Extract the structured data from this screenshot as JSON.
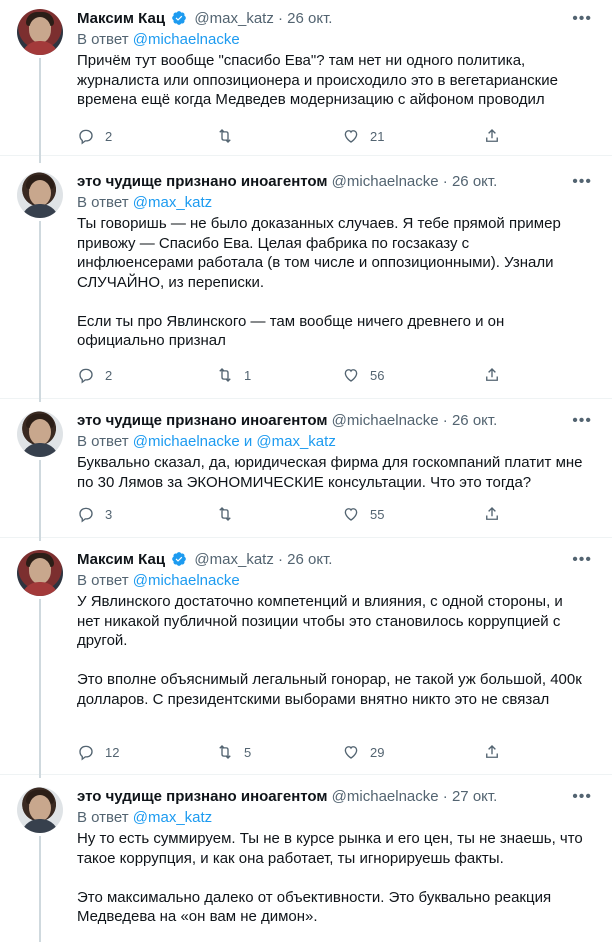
{
  "tweets": [
    {
      "name": "Максим Кац",
      "verified": true,
      "handle": "@max_katz",
      "date": "26 окт.",
      "reply_prefix": "В ответ ",
      "reply_mentions": "@michaelnacke",
      "text": "Причём тут вообще \"спасибо Ева\"? там нет ни одного политика, журналиста или оппозиционера и происходило это в вегетарианские времена ещё когда Медведев модернизацию с айфоном проводил",
      "replies": "2",
      "retweets": "",
      "likes": "21",
      "more": "•••"
    },
    {
      "name": "это чудище признано иноагентом",
      "verified": false,
      "handle": "@michaelnacke",
      "date": "26 окт.",
      "reply_prefix": "В ответ ",
      "reply_mentions": "@max_katz",
      "text": "Ты говоришь — не было доказанных случаев. Я тебе прямой пример привожу — Спасибо Ева. Целая фабрика по госзаказу с инфлюенсерами работала (в том числе и оппозиционными). Узнали СЛУЧАЙНО, из переписки.\n\nЕсли ты про Явлинского — там вообще ничего древнего и он официально признал",
      "replies": "2",
      "retweets": "1",
      "likes": "56",
      "more": "•••"
    },
    {
      "name": "это чудище признано иноагентом",
      "verified": false,
      "handle": "@michaelnacke",
      "date": "26 окт.",
      "reply_prefix": "В ответ ",
      "reply_mentions": "@michaelnacke и @max_katz",
      "text": "Буквально сказал, да, юридическая фирма для госкомпаний платит мне по 30 Лямов за ЭКОНОМИЧЕСКИЕ консультации. Что это тогда?",
      "replies": "3",
      "retweets": "",
      "likes": "55",
      "more": "•••"
    },
    {
      "name": "Максим Кац",
      "verified": true,
      "handle": "@max_katz",
      "date": "26 окт.",
      "reply_prefix": "В ответ ",
      "reply_mentions": "@michaelnacke",
      "text": "У Явлинского достаточно компетенций и влияния, с одной стороны, и нет никакой публичной позиции чтобы это становилось коррупцией с другой.\n\nЭто вполне объяснимый легальный гонорар, не такой уж большой, 400к долларов. С президентскими выборами внятно никто это не связал",
      "replies": "12",
      "retweets": "5",
      "likes": "29",
      "more": "•••"
    },
    {
      "name": "это чудище признано иноагентом",
      "verified": false,
      "handle": "@michaelnacke",
      "date": "27 окт.",
      "reply_prefix": "В ответ ",
      "reply_mentions": "@max_katz",
      "text": "Ну то есть суммируем. Ты не в курсе рынка и его цен, ты не знаешь, что такое коррупция, и как она работает, ты игнорируешь факты.\n\nЭто максимально далеко от объективности. Это буквально реакция Медведева на «он вам не димон».",
      "replies": "",
      "retweets": "",
      "likes": "",
      "more": "•••"
    }
  ],
  "colors": {
    "accent": "#1d9bf0",
    "secondary_text": "#536471",
    "thread_line": "#cfd9de"
  }
}
